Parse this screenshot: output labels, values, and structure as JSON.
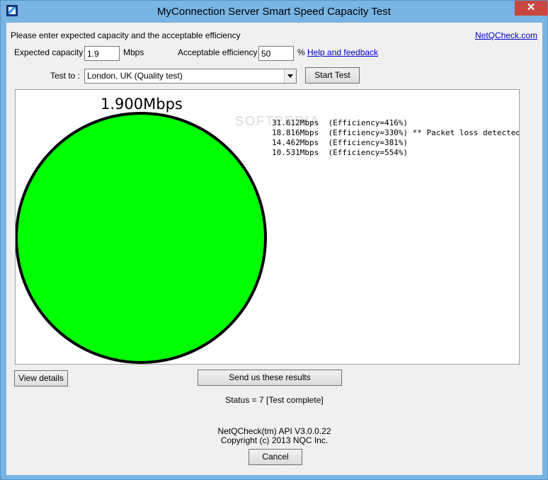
{
  "window": {
    "title": "MyConnection Server Smart Speed Capacity Test",
    "close_glyph": "✕"
  },
  "form": {
    "instructions": "Please enter expected capacity and the acceptable efficiency",
    "netq_link": "NetQCheck.com",
    "capacity_label": "Expected capacity :",
    "capacity_value": "1.9",
    "capacity_unit": "Mbps",
    "efficiency_label": "Acceptable efficiency :",
    "efficiency_value": "50",
    "efficiency_unit": "%",
    "help_link": "Help and feedback",
    "test_to_label": "Test to :",
    "test_to_selected": "London, UK (Quality test)",
    "start_button": "Start Test"
  },
  "results": {
    "speed_title": "1.900Mbps",
    "lines": [
      "31.612Mbps  (Efficiency=416%)",
      "18.816Mbps  (Efficiency=330%) ** Packet loss detected **",
      "14.462Mbps  (Efficiency=381%)",
      "10.531Mbps  (Efficiency=554%)"
    ],
    "watermark": "SOFTPEDIA",
    "gauge_color": "#00ff00"
  },
  "footer": {
    "view_details_button": "View details",
    "send_results_button": "Send us these results",
    "status": "Status = 7 [Test complete]",
    "api_version": "NetQCheck(tm) API V3.0.0.22",
    "copyright": "Copyright (c) 2013 NQC Inc.",
    "cancel_button": "Cancel"
  },
  "colors": {
    "titlebar": "#78b4e4",
    "close": "#c7463e",
    "link": "#0000cc"
  }
}
